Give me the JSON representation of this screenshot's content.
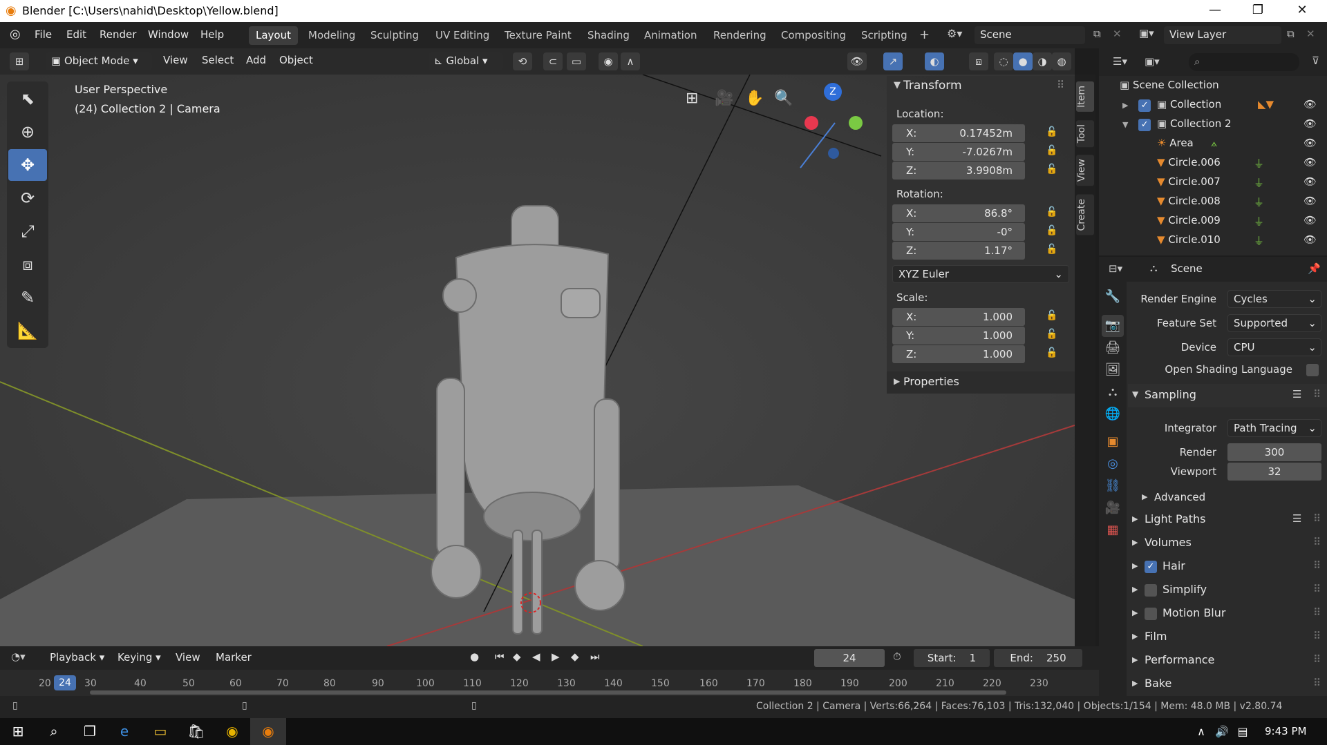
{
  "titlebar": {
    "title": "Blender [C:\\Users\\nahid\\Desktop\\Yellow.blend]",
    "minimize": "—",
    "maximize": "❐",
    "close": "✕"
  },
  "menu": {
    "logo": "◎",
    "items": [
      "File",
      "Edit",
      "Render",
      "Window",
      "Help"
    ]
  },
  "workspaces": [
    "Layout",
    "Modeling",
    "Sculpting",
    "UV Editing",
    "Texture Paint",
    "Shading",
    "Animation",
    "Rendering",
    "Compositing",
    "Scripting"
  ],
  "workspace_add": "+",
  "scene_field": "Scene",
  "viewlayer_field": "View Layer",
  "viewport_header": {
    "mode": "Object Mode",
    "menus": [
      "View",
      "Select",
      "Add",
      "Object"
    ],
    "transform_orientation": "Global"
  },
  "viewport": {
    "perspective": "User Perspective",
    "context": "(24) Collection 2 | Camera",
    "gizmo_z": "Z"
  },
  "transform_panel": {
    "title": "Transform",
    "location_label": "Location:",
    "location": [
      {
        "axis": "X:",
        "value": "0.17452m"
      },
      {
        "axis": "Y:",
        "value": "-7.0267m"
      },
      {
        "axis": "Z:",
        "value": "3.9908m"
      }
    ],
    "rotation_label": "Rotation:",
    "rotation": [
      {
        "axis": "X:",
        "value": "86.8°"
      },
      {
        "axis": "Y:",
        "value": "-0°"
      },
      {
        "axis": "Z:",
        "value": "1.17°"
      }
    ],
    "rotation_mode": "XYZ Euler",
    "scale_label": "Scale:",
    "scale": [
      {
        "axis": "X:",
        "value": "1.000"
      },
      {
        "axis": "Y:",
        "value": "1.000"
      },
      {
        "axis": "Z:",
        "value": "1.000"
      }
    ],
    "properties_label": "Properties"
  },
  "npanel_tabs": [
    "Item",
    "Tool",
    "View",
    "Create"
  ],
  "outliner": {
    "root": "Scene Collection",
    "rows": [
      {
        "name": "Collection",
        "type": "collection"
      },
      {
        "name": "Collection 2",
        "type": "collection"
      },
      {
        "name": "Area",
        "type": "light"
      },
      {
        "name": "Circle.006",
        "type": "mesh"
      },
      {
        "name": "Circle.007",
        "type": "mesh"
      },
      {
        "name": "Circle.008",
        "type": "mesh"
      },
      {
        "name": "Circle.009",
        "type": "mesh"
      },
      {
        "name": "Circle.010",
        "type": "mesh"
      }
    ]
  },
  "properties": {
    "header": "Scene",
    "render_engine_label": "Render Engine",
    "render_engine": "Cycles",
    "feature_set_label": "Feature Set",
    "feature_set": "Supported",
    "device_label": "Device",
    "device": "CPU",
    "osl_label": "Open Shading Language",
    "sampling": "Sampling",
    "integrator_label": "Integrator",
    "integrator": "Path Tracing",
    "render_label": "Render",
    "render_samples": "300",
    "viewport_label": "Viewport",
    "viewport_samples": "32",
    "advanced": "Advanced",
    "sections": [
      "Light Paths",
      "Volumes",
      "Hair",
      "Simplify",
      "Motion Blur",
      "Film",
      "Performance",
      "Bake"
    ]
  },
  "timeline": {
    "menus": [
      "Playback",
      "Keying",
      "View",
      "Marker"
    ],
    "current_frame": "24",
    "start_label": "Start:",
    "start": "1",
    "end_label": "End:",
    "end": "250",
    "ticks": [
      "20",
      "30",
      "40",
      "50",
      "60",
      "70",
      "80",
      "90",
      "100",
      "110",
      "120",
      "130",
      "140",
      "150",
      "160",
      "170",
      "180",
      "190",
      "200",
      "210",
      "220",
      "230"
    ]
  },
  "statusbar": {
    "stats": "Collection 2 | Camera | Verts:66,264 | Faces:76,103 | Tris:132,040 | Objects:1/154 | Mem: 48.0 MB | v2.80.74"
  },
  "taskbar": {
    "time": "9:43 PM"
  },
  "colors": {
    "accent": "#4772b3",
    "mesh_icon": "#e68a2e",
    "vertex_green": "#7ac943"
  }
}
